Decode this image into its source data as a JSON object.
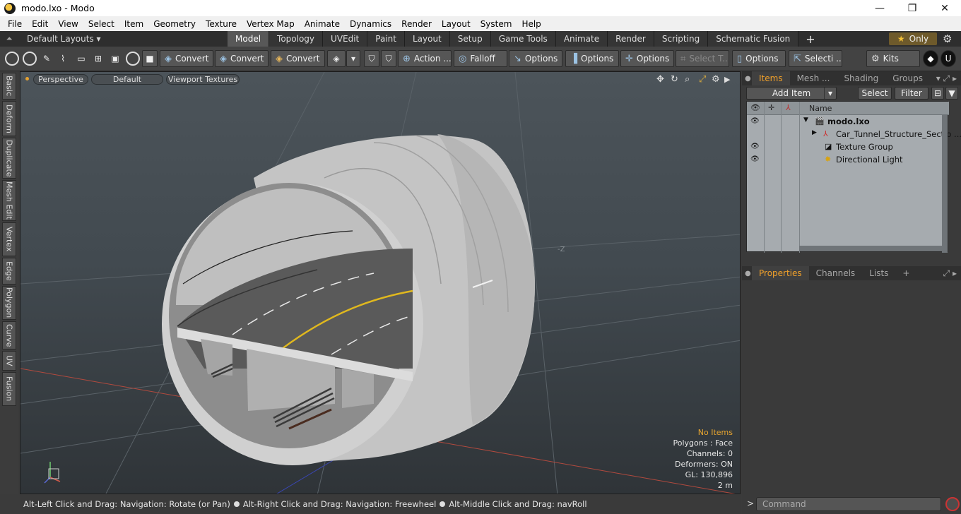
{
  "window": {
    "title": "modo.lxo - Modo",
    "minimize": "—",
    "maximize": "❐",
    "close": "✕"
  },
  "menu": [
    "File",
    "Edit",
    "View",
    "Select",
    "Item",
    "Geometry",
    "Texture",
    "Vertex Map",
    "Animate",
    "Dynamics",
    "Render",
    "Layout",
    "System",
    "Help"
  ],
  "layouts": {
    "default_label": "Default Layouts ▾",
    "tabs": [
      "Model",
      "Topology",
      "UVEdit",
      "Paint",
      "Layout",
      "Setup",
      "Game Tools",
      "Animate",
      "Render",
      "Scripting",
      "Schematic Fusion"
    ],
    "active_tab": "Model",
    "add": "+",
    "only_label": "Only",
    "only_star": "★",
    "gear": "⚙"
  },
  "toolbar": {
    "convert1": "Convert",
    "convert2": "Convert",
    "convert3": "Convert",
    "action": "Action ...",
    "falloff": "Falloff",
    "options1": "Options",
    "options2": "Options",
    "options3": "Options",
    "select_t": "Select T...",
    "options4": "Options",
    "selecti": "Selecti ...",
    "kits": "Kits"
  },
  "left_tabs": [
    "Basic",
    "Deform",
    "Duplicate",
    "Mesh Edit",
    "Vertex",
    "Edge",
    "Polygon",
    "Curve",
    "UV",
    "Fusion"
  ],
  "viewport": {
    "perspective": "Perspective",
    "default": "Default",
    "textures": "Viewport Textures",
    "axis_label": "-Z",
    "stats": {
      "no_items": "No Items",
      "polygons": "Polygons : Face",
      "channels": "Channels: 0",
      "deformers": "Deformers: ON",
      "gl": "GL: 130,896",
      "scale": "2 m"
    },
    "colors": {
      "background": "#48505a",
      "grid": "#5c646a",
      "x_axis": "#b24a3e",
      "z_axis": "#3a46b0",
      "concrete": "#c9c9c9",
      "road": "#5a5a5a",
      "yellow_line": "#e0b81e"
    }
  },
  "status": {
    "hint1": "Alt-Left Click and Drag: Navigation: Rotate (or Pan)",
    "hint2": "Alt-Right Click and Drag: Navigation: Freewheel",
    "hint3": "Alt-Middle Click and Drag: navRoll"
  },
  "items_panel": {
    "tabs": [
      "Items",
      "Mesh ...",
      "Shading",
      "Groups"
    ],
    "active_tab": "Items",
    "add_item": "Add Item",
    "select": "Select",
    "filter": "Filter",
    "column_name": "Name",
    "rows": [
      {
        "name": "modo.lxo",
        "bold": true,
        "visible": true
      },
      {
        "name": "Car_Tunnel_Structure_Sectio ...",
        "bold": false,
        "visible": true
      },
      {
        "name": "Texture Group",
        "bold": false,
        "visible": true
      },
      {
        "name": "Directional Light",
        "bold": false,
        "visible": true
      }
    ]
  },
  "properties_panel": {
    "tabs": [
      "Properties",
      "Channels",
      "Lists"
    ],
    "active_tab": "Properties",
    "add": "+"
  },
  "command": {
    "placeholder": "Command",
    "prompt": ">"
  }
}
